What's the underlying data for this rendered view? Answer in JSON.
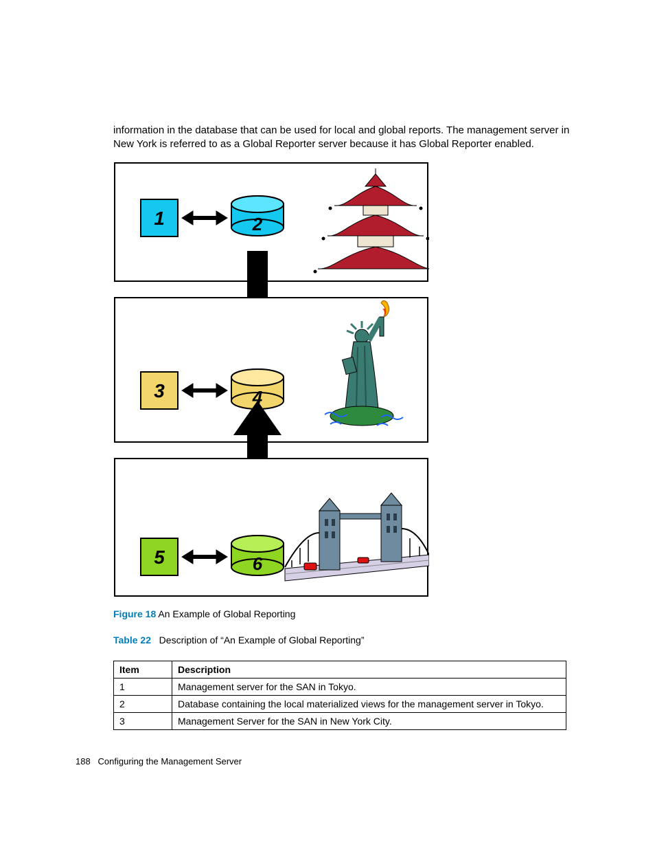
{
  "intro_text": "information in the database that can be used for local and global reports. The management server in New York is referred to as a Global Reporter server because it has Global Reporter enabled.",
  "figure": {
    "label": "Figure 18",
    "caption": "An Example of Global Reporting",
    "boxes": {
      "box1": "1",
      "box2": "2",
      "box3": "3",
      "box4": "4",
      "box5": "5",
      "box6": "6"
    }
  },
  "table": {
    "label": "Table 22",
    "caption": "Description of “An Example of Global Reporting”",
    "headers": {
      "item": "Item",
      "description": "Description"
    },
    "rows": [
      {
        "item": "1",
        "description": "Management server for the SAN in Tokyo."
      },
      {
        "item": "2",
        "description": "Database containing the local materialized views for the management server in Tokyo."
      },
      {
        "item": "3",
        "description": "Management Server for the SAN in New York City."
      }
    ]
  },
  "footer": {
    "page_number": "188",
    "section": "Configuring the Management Server"
  }
}
